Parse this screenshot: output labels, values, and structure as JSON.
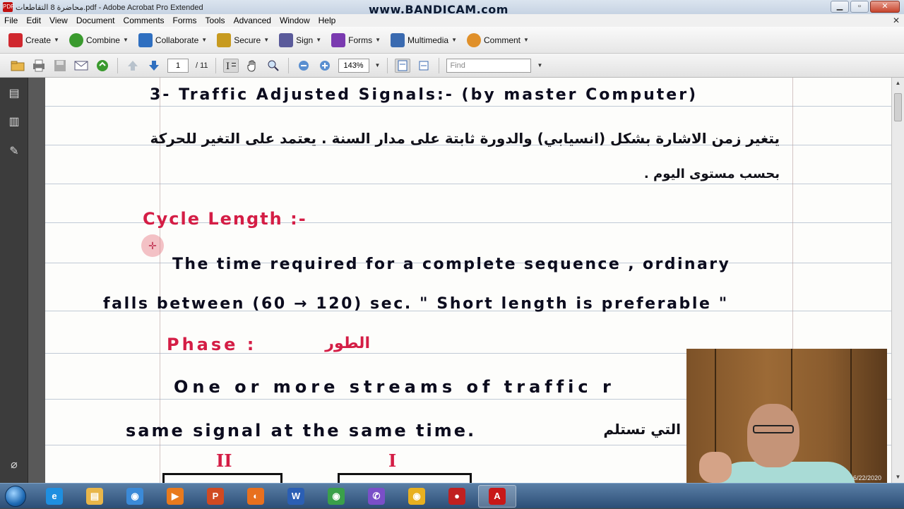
{
  "window": {
    "title": "محاضرة 8 التقاطعات.pdf - Adobe Acrobat Pro Extended",
    "watermark": "www.BANDICAM.com",
    "controls": {
      "minimize": "▁",
      "maximize": "▫",
      "close": "✕"
    }
  },
  "menu": [
    "File",
    "Edit",
    "View",
    "Document",
    "Comments",
    "Forms",
    "Tools",
    "Advanced",
    "Window",
    "Help"
  ],
  "menu_close": "✕",
  "toolbar1": [
    {
      "label": "Create",
      "icon": "create-icon",
      "color": "#d0282f"
    },
    {
      "label": "Combine",
      "icon": "combine-icon",
      "color": "#3a9a2e"
    },
    {
      "label": "Collaborate",
      "icon": "collaborate-icon",
      "color": "#2f6fc0"
    },
    {
      "label": "Secure",
      "icon": "lock-icon",
      "color": "#c79a1f"
    },
    {
      "label": "Sign",
      "icon": "pen-icon",
      "color": "#5a5a9a"
    },
    {
      "label": "Forms",
      "icon": "forms-icon",
      "color": "#7a3ab0"
    },
    {
      "label": "Multimedia",
      "icon": "multimedia-icon",
      "color": "#3a6ab0"
    },
    {
      "label": "Comment",
      "icon": "comment-icon",
      "color": "#e0902a"
    }
  ],
  "toolbar2": {
    "page_current": "1",
    "page_total": "/ 11",
    "zoom": "143%",
    "find_placeholder": "Find"
  },
  "document": {
    "lines": {
      "heading3": "3- Traffic Adjusted Signals:- (by master Computer)",
      "arabic1": "يتغير زمن الاشارة بشكل (انسيابي) والدورة ثابتة على مدار السنة . يعتمد على التغير للحركة",
      "arabic2": "بحسب مستوى اليوم .",
      "cycle_title": "Cycle Length :-",
      "cycle_l1": "The time required for a complete sequence , ordinary",
      "cycle_l2": "falls between (60 → 120) sec. \" Short length is preferable \"",
      "phase_title": "Phase :",
      "phase_ar": "الطور",
      "phase_l1": "One or more streams of traffic r",
      "phase_l2": "same signal at the same time.",
      "phase_ar2": "التي تستلم",
      "roman2": "II",
      "roman1": "I"
    }
  },
  "webcam": {
    "timestamp": "6/22/2020"
  },
  "taskbar": {
    "apps": [
      {
        "name": "ie-icon",
        "glyph": "e",
        "color": "#1e8fe0",
        "active": false
      },
      {
        "name": "explorer-icon",
        "glyph": "▤",
        "color": "#e8b64a",
        "active": false
      },
      {
        "name": "chrome-icon",
        "glyph": "◉",
        "color": "#3b8ad8",
        "active": false
      },
      {
        "name": "media-player-icon",
        "glyph": "▶",
        "color": "#e87a1e",
        "active": false
      },
      {
        "name": "powerpoint-icon",
        "glyph": "P",
        "color": "#d04a22",
        "active": false
      },
      {
        "name": "firefox-icon",
        "glyph": "◐",
        "color": "#e8701e",
        "active": false
      },
      {
        "name": "word-icon",
        "glyph": "W",
        "color": "#2b5fb4",
        "active": false
      },
      {
        "name": "chrome2-icon",
        "glyph": "◉",
        "color": "#3aa04a",
        "active": false
      },
      {
        "name": "viber-icon",
        "glyph": "✆",
        "color": "#7a4fc8",
        "active": false
      },
      {
        "name": "chrome-canary-icon",
        "glyph": "◉",
        "color": "#e8b020",
        "active": false
      },
      {
        "name": "recorder-icon",
        "glyph": "●",
        "color": "#c02020",
        "active": false
      },
      {
        "name": "acrobat-icon",
        "glyph": "A",
        "color": "#c81818",
        "active": true
      }
    ]
  }
}
